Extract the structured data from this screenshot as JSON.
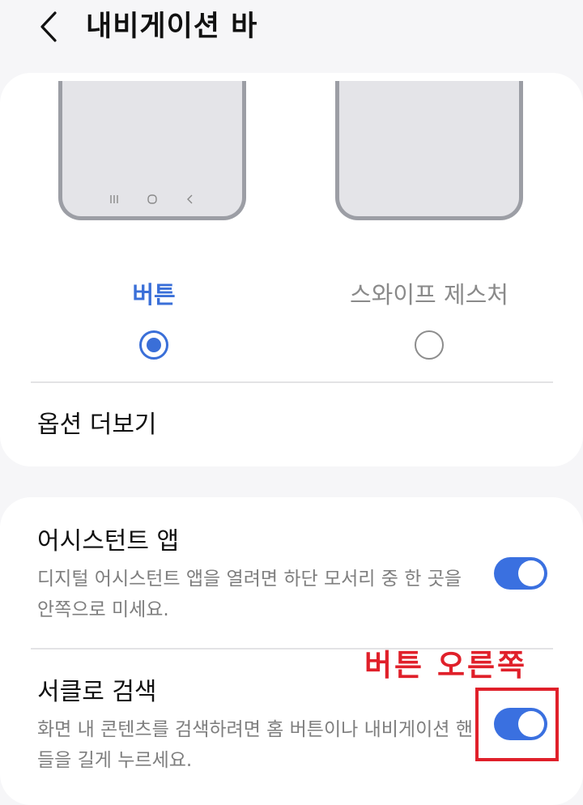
{
  "header": {
    "title": "내비게이션 바"
  },
  "navigation_type": {
    "options": [
      {
        "label": "버튼",
        "selected": true
      },
      {
        "label": "스와이프 제스처",
        "selected": false
      }
    ],
    "accent_color": "#3a6fd8"
  },
  "more_options": {
    "label": "옵션 더보기"
  },
  "settings": {
    "assistant_app": {
      "title": "어시스턴트 앱",
      "description": "디지털 어시스턴트 앱을 열려면 하단 모서리 중 한 곳을 안쪽으로 미세요.",
      "enabled": true
    },
    "circle_to_search": {
      "title": "서클로 검색",
      "description": "화면 내 콘텐츠를 검색하려면 홈 버튼이나 내비게이션 핸들을 길게 누르세요.",
      "enabled": true
    }
  },
  "annotation": {
    "text": "버튼 오른쪽",
    "color": "#e0202a"
  }
}
